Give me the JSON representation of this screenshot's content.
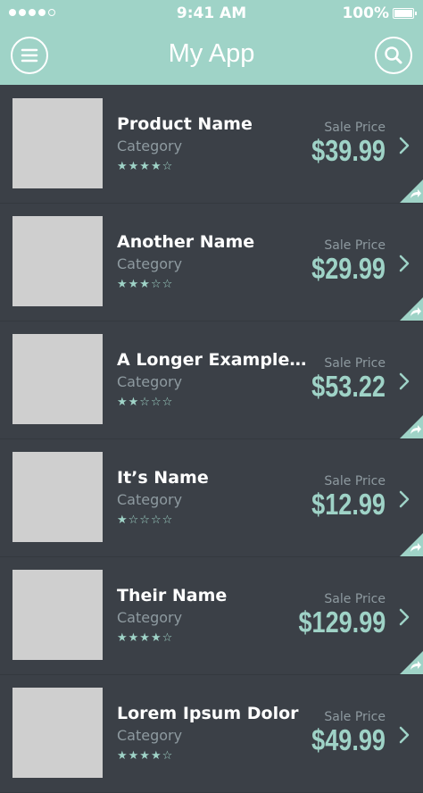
{
  "status_bar": {
    "time": "9:41 AM",
    "battery": "100%"
  },
  "nav": {
    "title": "My App",
    "left_icon": "menu-icon",
    "right_icon": "search-icon"
  },
  "colors": {
    "accent": "#9fd3c7",
    "background": "#3b4047",
    "thumb": "#cfcfcf",
    "muted": "#8e9aa0"
  },
  "products": [
    {
      "name": "Product Name",
      "category": "Category",
      "stars": "★★★★☆",
      "rating": 4,
      "sale_label": "Sale Price",
      "price": "$39.99"
    },
    {
      "name": "Another Name",
      "category": "Category",
      "stars": "★★★☆☆",
      "rating": 3,
      "sale_label": "Sale Price",
      "price": "$29.99"
    },
    {
      "name": "A Longer Example Name",
      "category": "Category",
      "stars": "★★☆☆☆",
      "rating": 2,
      "sale_label": "Sale Price",
      "price": "$53.22"
    },
    {
      "name": "It’s Name",
      "category": "Category",
      "stars": "★☆☆☆☆",
      "rating": 1,
      "sale_label": "Sale Price",
      "price": "$12.99"
    },
    {
      "name": "Their Name",
      "category": "Category",
      "stars": "★★★★☆",
      "rating": 4,
      "sale_label": "Sale Price",
      "price": "$129.99"
    },
    {
      "name": "Lorem Ipsum Dolor",
      "category": "Category",
      "stars": "★★★★☆",
      "rating": 4,
      "sale_label": "Sale Price",
      "price": "$49.99"
    }
  ]
}
